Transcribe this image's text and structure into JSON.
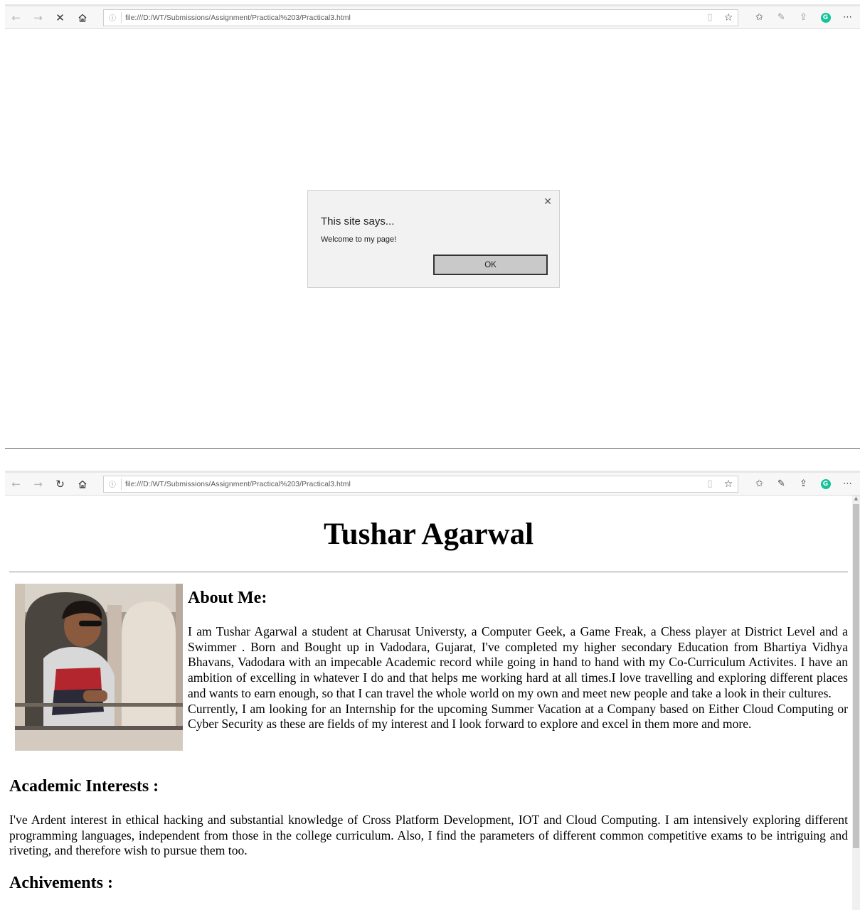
{
  "browser_top": {
    "url": "file:///D:/WT/Submissions/Assignment/Practical%203/Practical3.html",
    "nav_icons": [
      "back-arrow-icon",
      "forward-arrow-icon",
      "stop-icon",
      "home-icon"
    ]
  },
  "browser_bottom": {
    "url": "file:///D:/WT/Submissions/Assignment/Practical%203/Practical3.html",
    "nav_icons": [
      "back-arrow-icon",
      "forward-arrow-icon",
      "refresh-icon",
      "home-icon"
    ]
  },
  "dialog": {
    "title": "This site says...",
    "message": "Welcome to my page!",
    "ok_label": "OK"
  },
  "page": {
    "heading": "Tushar Agarwal",
    "about_heading": "About Me:",
    "about_p1": "I am Tushar Agarwal a student at Charusat Universty, a Computer Geek, a Game Freak, a Chess player at District Level and a Swimmer . Born and Bought up in Vadodara, Gujarat, I've completed my higher secondary Education from Bhartiya Vidhya Bhavans, Vadodara with an impecable Academic record while going in hand to hand with my Co-Curriculum Activites. I have an ambition of excelling in whatever I do and that helps me working hard at all times.I love travelling and exploring different places and wants to earn enough, so that I can travel the whole world on my own and meet new people and take a look in their cultures.",
    "about_p2": "Currently, I am looking for an Internship for the upcoming Summer Vacation at a Company based on Either Cloud Computing or Cyber Security as these are fields of my interest and I look forward to explore and excel in them more and more.",
    "academic_heading": "Academic Interests :",
    "academic_text": "I've Ardent interest in ethical hacking and substantial knowledge of Cross Platform Development, IOT and Cloud Computing. I am intensively exploring different programming languages, independent from those in the college curriculum. Also, I find the parameters of different common competitive exams to be intriguing and riveting, and therefore wish to pursue them too.",
    "achievements_heading": "Achivements :"
  },
  "colors": {
    "grammarly": "#15c39a",
    "dialog_bg": "#f2f2f2",
    "ok_button_bg": "#c9c9c9"
  }
}
